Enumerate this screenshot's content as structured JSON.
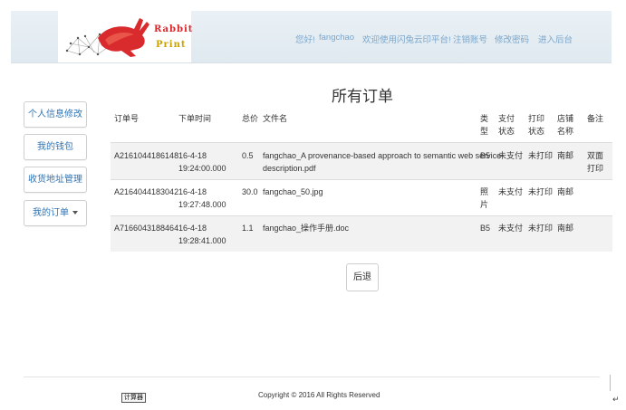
{
  "header": {
    "logo_line1": "Rabbit",
    "logo_line2": "Print",
    "greeting": "您好!",
    "username": "fangchao",
    "welcome": "欢迎使用闪兔云印平台!",
    "logout": "注销账号",
    "change_password": "修改密码",
    "admin": "进入后台"
  },
  "sidebar": {
    "items": [
      {
        "label": "个人信息修改"
      },
      {
        "label": "我的钱包"
      },
      {
        "label": "收货地址管理"
      },
      {
        "label": "我的订单"
      }
    ]
  },
  "main": {
    "title": "所有订单",
    "columns": {
      "order_no": "订单号",
      "order_time": "下单时间",
      "total": "总价",
      "filename": "文件名",
      "type": "类型",
      "pay_status": "支付状态",
      "print_status": "打印状态",
      "shop": "店铺名称",
      "note": "备注"
    },
    "rows": [
      {
        "order_no": "A2161044186148",
        "time_date": "16-4-18",
        "time_clock": "19:24:00.000",
        "total": "0.5",
        "filename_line1": "fangchao_A provenance-based approach to semantic web service",
        "filename_line2": "description.pdf",
        "type": "B5",
        "pay_status": "未支付",
        "print_status": "未打印",
        "shop": "南邮",
        "note": "双面打印"
      },
      {
        "order_no": "A2164044183042",
        "time_date": "16-4-18",
        "time_clock": "19:27:48.000",
        "total": "30.0",
        "filename_line1": "fangchao_50.jpg",
        "filename_line2": "",
        "type": "照片",
        "pay_status": "未支付",
        "print_status": "未打印",
        "shop": "南邮",
        "note": ""
      },
      {
        "order_no": "A7166043188464",
        "time_date": "16-4-18",
        "time_clock": "19:28:41.000",
        "total": "1.1",
        "filename_line1": "fangchao_操作手册.doc",
        "filename_line2": "",
        "type": "B5",
        "pay_status": "未支付",
        "print_status": "未打印",
        "shop": "南邮",
        "note": ""
      }
    ],
    "back_label": "后退"
  },
  "footer": {
    "calc_label": "计算器",
    "copyright": "Copyright © 2016 All Rights Reserved",
    "mark": "↵"
  },
  "colors": {
    "link": "#7aa6cc",
    "sidebar_link": "#2f74b5",
    "logo_red": "#d9262b",
    "logo_gold": "#c9a200",
    "stripe": "#f2f2f2"
  }
}
